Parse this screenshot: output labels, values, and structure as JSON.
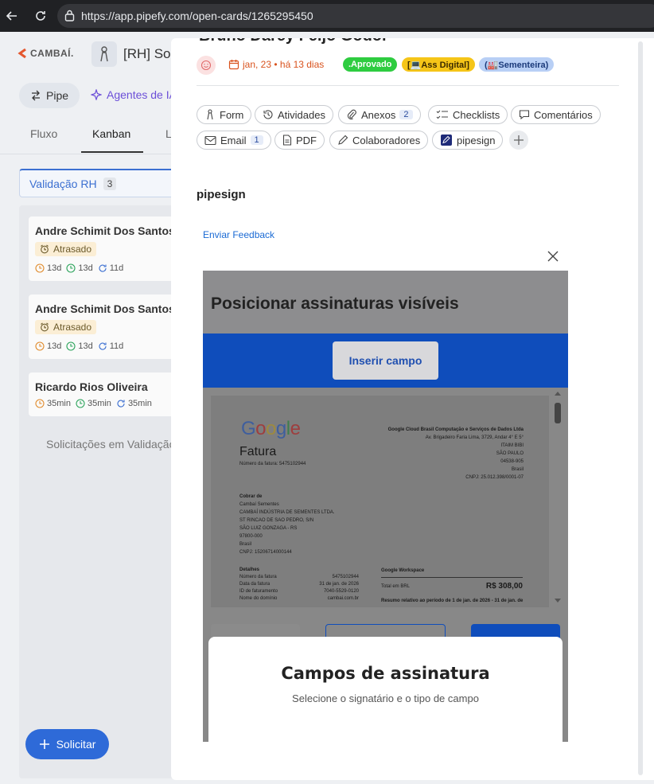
{
  "browser": {
    "url": "https://app.pipefy.com/open-cards/1265295450"
  },
  "app": {
    "logo_text": "CAMBAÍ.",
    "pipe_title": "[RH] Sol",
    "pipe_chip": "Pipe",
    "agents_label": "Agentes de IA",
    "tabs": [
      "Fluxo",
      "Kanban",
      "L"
    ],
    "phase": {
      "name": "Validação RH",
      "count": "3"
    },
    "cards": [
      {
        "name": "Andre Schimit Dos Santos",
        "status": "Atrasado",
        "times": [
          "13d",
          "13d",
          "11d"
        ]
      },
      {
        "name": "Andre Schimit Dos Santos",
        "status": "Atrasado",
        "times": [
          "13d",
          "13d",
          "11d"
        ]
      },
      {
        "name": "Ricardo Rios Oliveira",
        "status": "",
        "times": [
          "35min",
          "35min",
          "35min"
        ]
      }
    ],
    "column_footer": "Solicitações em Validação",
    "solicitar_button": "Solicitar"
  },
  "modal": {
    "title": "Bruno Darcy Feijó Godoi",
    "due_date": "jan, 23 • há 13 dias",
    "labels": [
      {
        "text": ".Aprovado",
        "bg": "#2ecc40",
        "fg": "#ffffff"
      },
      {
        "text": "[💻Ass Digital]",
        "bg": "#f5c518",
        "fg": "#3a2a00"
      },
      {
        "text": "(🏭Sementeira)",
        "bg": "#b8cff5",
        "fg": "#1b3a7a"
      }
    ],
    "pills": {
      "form": "Form",
      "atividades": "Atividades",
      "anexos": "Anexos",
      "anexos_count": "2",
      "checklists": "Checklists",
      "comentarios": "Comentários",
      "email": "Email",
      "email_count": "1",
      "pdf": "PDF",
      "colaboradores": "Colaboradores",
      "pipesign": "pipesign"
    },
    "section_title": "pipesign",
    "feedback_link": "Enviar Feedback",
    "frame": {
      "title": "Posicionar assinaturas visíveis",
      "insert_button": "Inserir campo",
      "doc": {
        "brand": "Google",
        "doc_title": "Fatura",
        "invoice_number": "Número da fatura: 5475102944",
        "company": "Google Cloud Brasil Computação e Serviços de Dados Ltda",
        "address1": "Av. Brigadeiro Faria Lima, 3729, Andar 4° E 5°",
        "address2": "ITAIM BIBI",
        "address3": "SÃO PAULO",
        "address4": "04538-905",
        "address5": "Brasil",
        "cnpj": "CNPJ: 25.012.398/0001-07",
        "bill_to_label": "Cobrar de",
        "bill1": "Cambaí Sementes",
        "bill2": "CAMBAÍ INDÚSTRIA DE SEMENTES LTDA.",
        "bill3": "ST RINCAO DE SAO PEDRO, S/N",
        "bill4": "SÃO LUIZ GONZAGA - RS",
        "bill5": "97800-000",
        "bill6": "Brasil",
        "bill7": "CNPJ: 15206714000144",
        "details_label": "Detalhes",
        "d1": "Número da fatura",
        "d1v": "5475102944",
        "d2": "Data da fatura",
        "d2v": "31 de jan. de 2026",
        "d3": "ID de faturamento",
        "d3v": "7040-5529-0120",
        "d4": "Nome do domínio",
        "d4v": "cambai.com.br",
        "workspace": "Google Workspace",
        "total_label": "Total em BRL",
        "total": "R$ 308,00",
        "summary": "Resumo relativo ao período de 1 de jan. de 2026 - 31 de jan. de"
      },
      "sheet_title": "Campos de assinatura",
      "sheet_subtitle": "Selecione o signatário e o tipo de campo"
    }
  }
}
